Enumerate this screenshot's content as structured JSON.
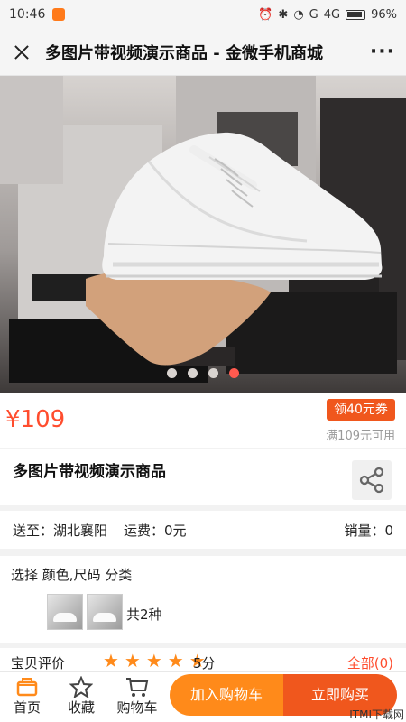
{
  "statusbar": {
    "time": "10:46",
    "network": "G",
    "network2": "4G",
    "battery": "96%"
  },
  "titlebar": {
    "title": "多图片带视频演示商品 - 金微手机商城",
    "more": "···"
  },
  "gallery": {
    "dots": 4,
    "active_dot": 3
  },
  "product": {
    "price": "¥109",
    "coupon_label": "领40元券",
    "coupon_condition": "满109元可用",
    "title": "多图片带视频演示商品"
  },
  "shipping": {
    "label": "送至：湖北襄阳",
    "fee": "运费：0元",
    "sales": "销量：0"
  },
  "selection": {
    "title": "选择 颜色,尺码 分类",
    "kinds": "共2种"
  },
  "reviews": {
    "label": "宝贝评价",
    "stars": "★★★★★",
    "score": "5分",
    "all": "全部(0)"
  },
  "bottom": {
    "home": "首页",
    "favorite": "收藏",
    "cart": "购物车",
    "add_cart": "加入购物车",
    "buy_now": "立即购买"
  },
  "watermark": "ITMI下载网",
  "colors": {
    "accent": "#ff4d2e",
    "button_orange": "#ff8a1a",
    "button_red": "#f0571d"
  }
}
